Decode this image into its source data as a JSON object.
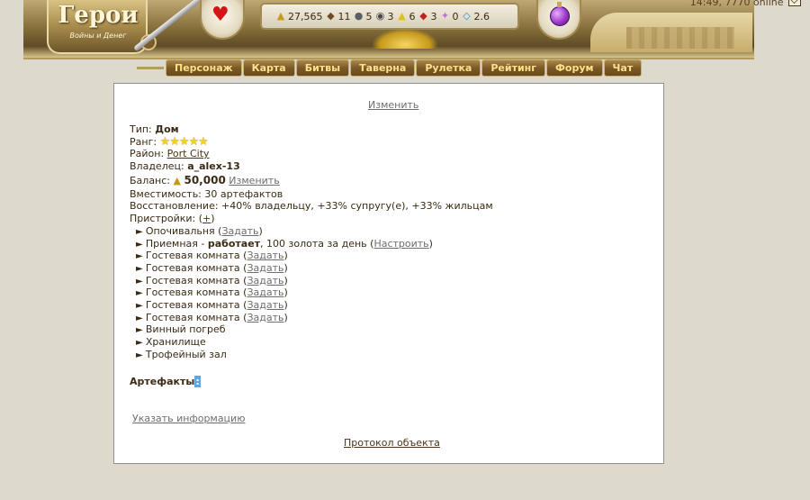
{
  "header": {
    "logo_title": "Герои",
    "logo_subtitle": "Войны и Денег",
    "clock_text": "14:49, 7770 online",
    "resources": [
      {
        "icon": "gold-icon",
        "glyph": "▲",
        "value": "27,565"
      },
      {
        "icon": "wood-icon",
        "glyph": "◆",
        "value": "11"
      },
      {
        "icon": "ore-icon",
        "glyph": "●",
        "value": "5"
      },
      {
        "icon": "mercury-icon",
        "glyph": "◉",
        "value": "3"
      },
      {
        "icon": "sulfur-icon",
        "glyph": "▲",
        "value": "6"
      },
      {
        "icon": "crystal-icon",
        "glyph": "◆",
        "value": "3"
      },
      {
        "icon": "gems-icon",
        "glyph": "✦",
        "value": "0"
      },
      {
        "icon": "diamond-icon",
        "glyph": "◇",
        "value": "2.6"
      }
    ],
    "nav": [
      "Персонаж",
      "Карта",
      "Битвы",
      "Таверна",
      "Рулетка",
      "Рейтинг",
      "Форум",
      "Чат"
    ]
  },
  "panel": {
    "change_link": "Изменить",
    "type_label": "Тип: ",
    "type_value": "Дом",
    "rank_label": "Ранг: ",
    "rank_stars": "★★★★★",
    "district_label": "Район: ",
    "district_value": "Port City",
    "owner_label": "Владелец: ",
    "owner_value": "a_alex-13",
    "balance_label": "Баланс: ",
    "balance_value": "50,000",
    "balance_change": "Изменить",
    "capacity": "Вместимость: 30 артефактов",
    "restore": "Восстановление: +40% владельцу, +33% супругу(е), +33% жильцам",
    "addons_label": "Пристройки: (",
    "addons_plus": "+",
    "addons_close": ")",
    "addons": [
      {
        "name": "Опочивальня",
        "open": " (",
        "link": "Задать",
        "close": ")"
      },
      {
        "name": "Приемная - ",
        "bold": "работает",
        "rest": ", 100 золота за день",
        "open": " (",
        "link": "Настроить",
        "close": ")"
      },
      {
        "name": "Гостевая комната",
        "open": " (",
        "link": "Задать",
        "close": ")"
      },
      {
        "name": "Гостевая комната",
        "open": " (",
        "link": "Задать",
        "close": ")"
      },
      {
        "name": "Гостевая комната",
        "open": " (",
        "link": "Задать",
        "close": ")"
      },
      {
        "name": "Гостевая комната",
        "open": " (",
        "link": "Задать",
        "close": ")"
      },
      {
        "name": "Гостевая комната",
        "open": " (",
        "link": "Задать",
        "close": ")"
      },
      {
        "name": "Гостевая комната",
        "open": " (",
        "link": "Задать",
        "close": ")"
      },
      {
        "name": "Винный погреб"
      },
      {
        "name": "Хранилище"
      },
      {
        "name": "Трофейный зал"
      }
    ],
    "artifacts_label": "Артефакты",
    "artifacts_colon": ":",
    "provide_info": "Указать информацию",
    "protocol": "Протокол объекта"
  }
}
